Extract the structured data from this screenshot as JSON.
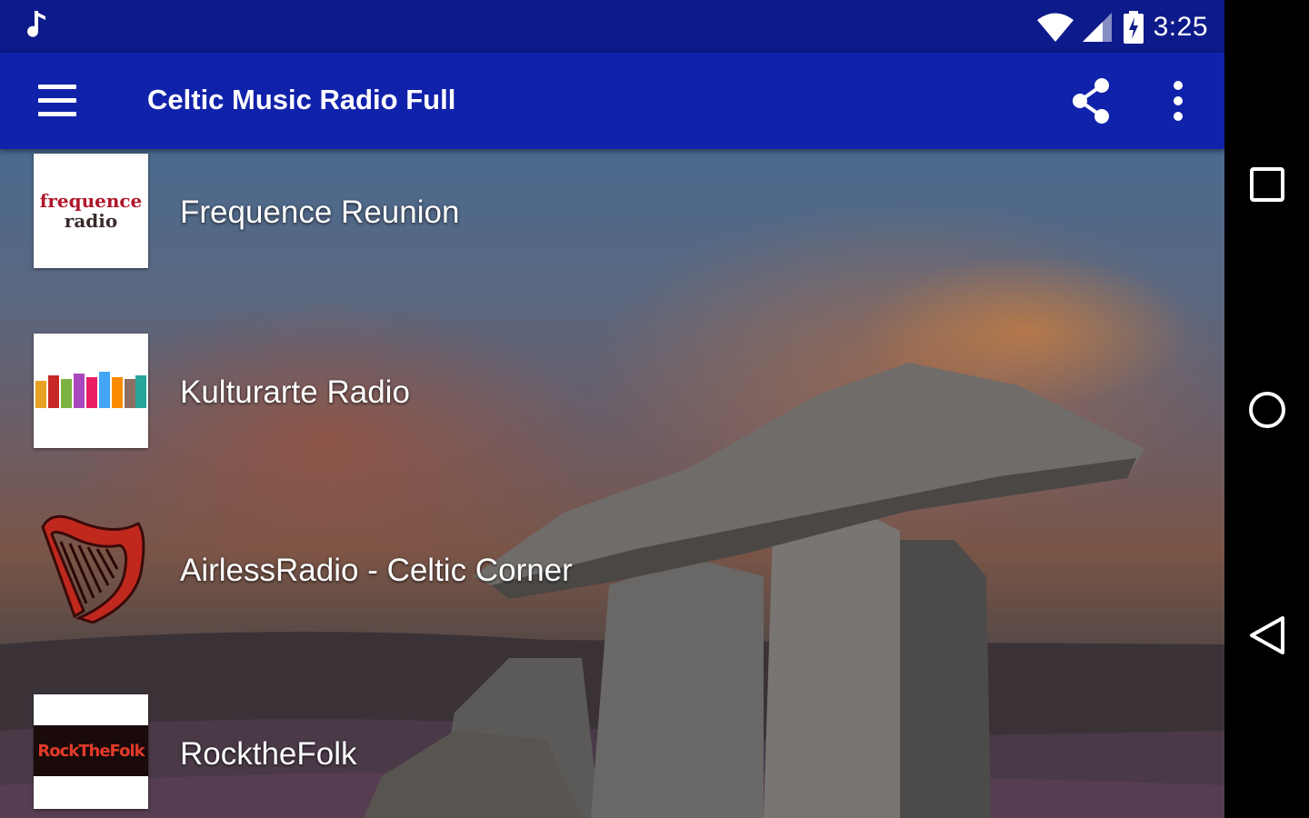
{
  "status_bar": {
    "time": "3:25",
    "icons": [
      "music-note-icon",
      "wifi-icon",
      "signal-icon",
      "battery-charging-icon"
    ]
  },
  "app_bar": {
    "title": "Celtic Music Radio Full",
    "icons": [
      "menu-icon",
      "share-icon",
      "more-vert-icon"
    ]
  },
  "stations": [
    {
      "name": "Frequence Reunion",
      "logo_line1": "frequence",
      "logo_line2": "radio"
    },
    {
      "name": "Kulturarte Radio"
    },
    {
      "name": "AirlessRadio - Celtic Corner"
    },
    {
      "name": "RocktheFolk",
      "logo_text": "RockTheFolk"
    }
  ],
  "nav_bar": {
    "icons": [
      "recents-square-icon",
      "home-circle-icon",
      "back-triangle-icon"
    ]
  },
  "colors": {
    "status_bar": "#0d1a8a",
    "app_bar": "#1122aa",
    "nav_bar": "#000000",
    "text": "#ffffff"
  }
}
